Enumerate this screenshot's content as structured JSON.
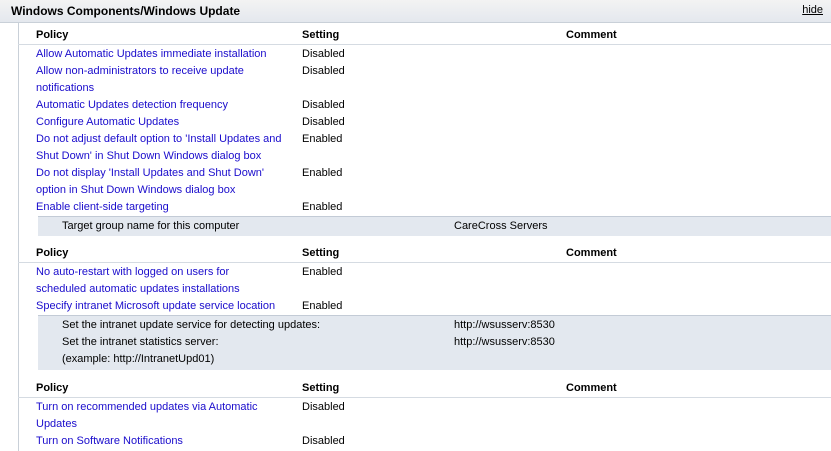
{
  "section": {
    "title": "Windows Components/Windows Update",
    "hide_label": "hide"
  },
  "columns": {
    "policy": "Policy",
    "setting": "Setting",
    "comment": "Comment"
  },
  "groups": [
    {
      "rows": [
        {
          "policy": "Allow Automatic Updates immediate installation",
          "setting": "Disabled"
        },
        {
          "policy": "Allow non-administrators to receive update notifications",
          "setting": "Disabled"
        },
        {
          "policy": "Automatic Updates detection frequency",
          "setting": "Disabled"
        },
        {
          "policy": "Configure Automatic Updates",
          "setting": "Disabled"
        },
        {
          "policy": "Do not adjust default option to 'Install Updates and Shut Down' in Shut Down Windows dialog box",
          "setting": "Enabled"
        },
        {
          "policy": "Do not display 'Install Updates and Shut Down' option in Shut Down Windows dialog box",
          "setting": "Enabled"
        },
        {
          "policy": "Enable client-side targeting",
          "setting": "Enabled"
        }
      ],
      "option": {
        "label": "Target group name for this computer",
        "value": "CareCross Servers"
      }
    },
    {
      "rows": [
        {
          "policy": "No auto-restart with logged on users for scheduled automatic updates installations",
          "setting": "Enabled"
        },
        {
          "policy": "Specify intranet Microsoft update service location",
          "setting": "Enabled"
        }
      ],
      "options": [
        {
          "label": "Set the intranet update service for detecting updates:",
          "value": "http://wsusserv:8530"
        },
        {
          "label": "Set the intranet statistics server:",
          "value": "http://wsusserv:8530"
        }
      ],
      "note": "(example: http://IntranetUpd01)"
    },
    {
      "rows": [
        {
          "policy": "Turn on recommended updates via Automatic Updates",
          "setting": "Disabled"
        },
        {
          "policy": "Turn on Software Notifications",
          "setting": "Disabled"
        }
      ]
    }
  ]
}
